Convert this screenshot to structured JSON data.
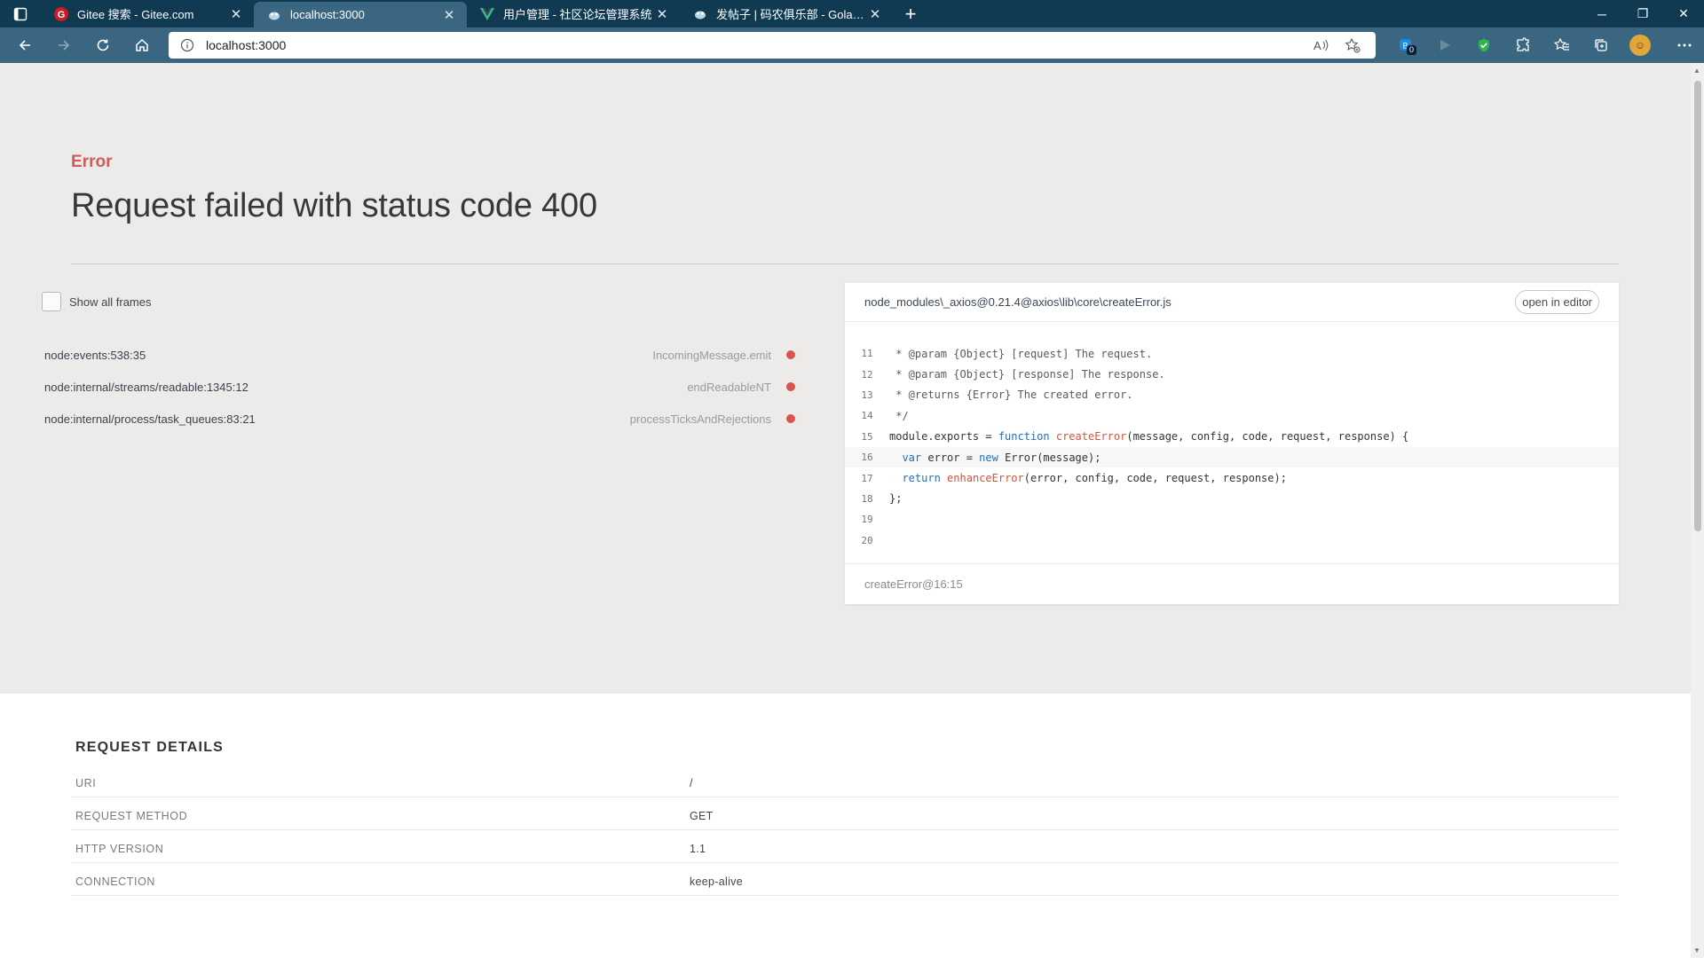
{
  "browser": {
    "tabs": [
      {
        "title": "Gitee 搜索 - Gitee.com",
        "favicon": "gitee-icon",
        "active": false
      },
      {
        "title": "localhost:3000",
        "favicon": "gopher-icon",
        "active": true
      },
      {
        "title": "用户管理 - 社区论坛管理系统",
        "favicon": "vue-icon",
        "active": false
      },
      {
        "title": "发帖子 | 码农俱乐部 - Golang中文社区",
        "favicon": "gopher-icon",
        "active": false
      }
    ],
    "address": {
      "url": "localhost:3000"
    },
    "extension_badge": "0"
  },
  "error": {
    "label": "Error",
    "message": "Request failed with status code 400"
  },
  "frames": {
    "show_all_label": "Show all frames",
    "items": [
      {
        "location": "node:events:538:35",
        "function": "IncomingMessage.emit"
      },
      {
        "location": "node:internal/streams/readable:1345:12",
        "function": "endReadableNT"
      },
      {
        "location": "node:internal/process/task_queues:83:21",
        "function": "processTicksAndRejections"
      }
    ]
  },
  "code": {
    "file_path": "node_modules\\_axios@0.21.4@axios\\lib\\core\\createError.js",
    "open_in_editor": "open in editor",
    "highlight_line": 16,
    "lines": [
      {
        "n": "11",
        "text": " * @param {Object} [request] The request."
      },
      {
        "n": "12",
        "text": " * @param {Object} [response] The response."
      },
      {
        "n": "13",
        "text": " * @returns {Error} The created error."
      },
      {
        "n": "14",
        "text": " */"
      },
      {
        "n": "15",
        "text": "module.exports = function createError(message, config, code, request, response) {"
      },
      {
        "n": "16",
        "text": "  var error = new Error(message);"
      },
      {
        "n": "17",
        "text": "  return enhanceError(error, config, code, request, response);"
      },
      {
        "n": "18",
        "text": "};"
      },
      {
        "n": "19",
        "text": ""
      },
      {
        "n": "20",
        "text": ""
      }
    ],
    "footer": "createError@16:15"
  },
  "request": {
    "title": "REQUEST DETAILS",
    "rows": [
      {
        "key": "URI",
        "value": "/"
      },
      {
        "key": "REQUEST METHOD",
        "value": "GET"
      },
      {
        "key": "HTTP VERSION",
        "value": "1.1"
      },
      {
        "key": "CONNECTION",
        "value": "keep-alive"
      }
    ]
  },
  "colors": {
    "accent_error": "#d35a5a",
    "tabbar": "#0f3a52",
    "toolbar": "#3a6682",
    "page_bg": "#ecebea"
  }
}
